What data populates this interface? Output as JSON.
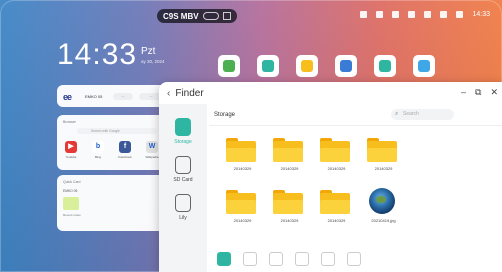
{
  "device": {
    "name": "C9S MBV"
  },
  "status": {
    "time": "14:33"
  },
  "clock": {
    "time": "14:33",
    "day": "Pzt",
    "date": "ay 30, 2024"
  },
  "dock": {
    "apps": [
      {
        "icon": "whiteboard-icon",
        "label": "",
        "color": "#4caf50"
      },
      {
        "icon": "notes-icon",
        "label": "",
        "color": "#2eb6a2"
      },
      {
        "icon": "finder-icon",
        "label": "",
        "color": "#f7be1d"
      },
      {
        "icon": "browser-icon",
        "label": "",
        "color": "#3a7bd5"
      },
      {
        "icon": "screen-share-icon",
        "label": "",
        "color": "#2eb6a2"
      },
      {
        "icon": "cloud-icon",
        "label": "",
        "color": "#3fa7e6"
      }
    ]
  },
  "widgets": {
    "brand": {
      "logo": "ee",
      "name": "EMKO 05",
      "button1": "...",
      "button2": "..."
    },
    "browser": {
      "header": "Browser",
      "search_placeholder": "Search with Google",
      "tiles": [
        {
          "label": "Youtube",
          "glyph": "▶",
          "color": "#e53935"
        },
        {
          "label": "Bing",
          "glyph": "b",
          "color": "#ffffff"
        },
        {
          "label": "Facebook",
          "glyph": "f",
          "color": "#3b5998"
        },
        {
          "label": "Wikipedia",
          "glyph": "W",
          "color": "#e0e0e0"
        }
      ]
    },
    "quick": {
      "header": "Quick Card",
      "sub": "EMKO 05",
      "file_caption": "Recent notes"
    }
  },
  "finder": {
    "title": "Finder",
    "breadcrumb": "Storage",
    "search_placeholder": "Search",
    "sidebar": [
      {
        "label": "Storage",
        "icon": "storage-icon",
        "active": true
      },
      {
        "label": "SD Card",
        "icon": "sd-card-icon",
        "active": false
      },
      {
        "label": "Lily",
        "icon": "device-icon",
        "active": false
      }
    ],
    "files": [
      {
        "name": "20140329",
        "type": "folder"
      },
      {
        "name": "20140329",
        "type": "folder"
      },
      {
        "name": "20140329",
        "type": "folder"
      },
      {
        "name": "20140329",
        "type": "folder"
      },
      {
        "name": "20140329",
        "type": "folder"
      },
      {
        "name": "20140329",
        "type": "folder"
      },
      {
        "name": "20140329",
        "type": "folder"
      },
      {
        "name": "20210419.jpg",
        "type": "image"
      }
    ],
    "toolbar": [
      {
        "icon": "grid-view-icon",
        "label": "",
        "active": true
      },
      {
        "icon": "list-view-icon",
        "label": "",
        "active": false
      },
      {
        "icon": "sort-icon",
        "label": "",
        "active": false
      },
      {
        "icon": "select-icon",
        "label": "",
        "active": false
      },
      {
        "icon": "new-folder-icon",
        "label": "",
        "active": false
      },
      {
        "icon": "more-icon",
        "label": "",
        "active": false
      }
    ]
  },
  "colors": {
    "accent": "#2eb6a2",
    "folder": "#f7be1d"
  }
}
